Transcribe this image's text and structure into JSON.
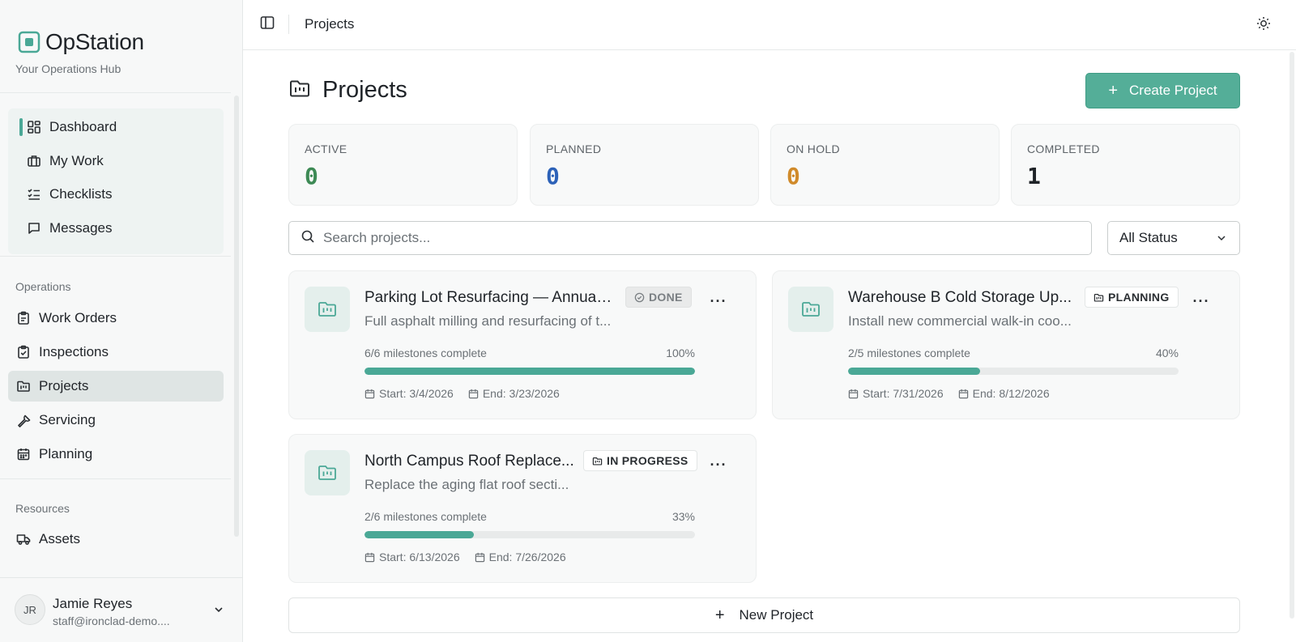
{
  "brand": {
    "title": "OpStation",
    "subtitle": "Your Operations Hub",
    "accent": "#4aa896"
  },
  "sidebar": {
    "top_items": [
      {
        "label": "Dashboard",
        "icon": "grid-icon"
      },
      {
        "label": "My Work",
        "icon": "briefcase-icon"
      },
      {
        "label": "Checklists",
        "icon": "checklist-icon"
      },
      {
        "label": "Messages",
        "icon": "message-icon"
      }
    ],
    "operations_label": "Operations",
    "operations_items": [
      {
        "label": "Work Orders",
        "icon": "clipboard-icon"
      },
      {
        "label": "Inspections",
        "icon": "clipboard-check-icon"
      },
      {
        "label": "Projects",
        "icon": "folder-kanban-icon",
        "active": true
      },
      {
        "label": "Servicing",
        "icon": "wrench-icon"
      },
      {
        "label": "Planning",
        "icon": "calendar-icon"
      }
    ],
    "resources_label": "Resources",
    "resources_items": [
      {
        "label": "Assets",
        "icon": "truck-icon"
      }
    ]
  },
  "user": {
    "initials": "JR",
    "name": "Jamie Reyes",
    "email": "staff@ironclad-demo...."
  },
  "topbar": {
    "breadcrumb": "Projects"
  },
  "page": {
    "title": "Projects",
    "create_label": "Create Project",
    "new_project_label": "New Project"
  },
  "stats": [
    {
      "label": "ACTIVE",
      "value": "0",
      "color": "#3d8a55"
    },
    {
      "label": "PLANNED",
      "value": "0",
      "color": "#2d62b8"
    },
    {
      "label": "ON HOLD",
      "value": "0",
      "color": "#d08a2a"
    },
    {
      "label": "COMPLETED",
      "value": "1",
      "color": "#1f2328"
    }
  ],
  "search": {
    "placeholder": "Search projects..."
  },
  "filter": {
    "selected": "All Status"
  },
  "projects": [
    {
      "title": "Parking Lot Resurfacing — Annual C...",
      "description": "Full asphalt milling and resurfacing of t...",
      "status": "DONE",
      "milestones": "6/6 milestones complete",
      "percent_label": "100%",
      "progress": 1.0,
      "start": "Start: 3/4/2026",
      "end": "End: 3/23/2026"
    },
    {
      "title": "Warehouse B Cold Storage Up...",
      "description": "Install new commercial walk-in coo...",
      "status": "PLANNING",
      "milestones": "2/5 milestones complete",
      "percent_label": "40%",
      "progress": 0.4,
      "start": "Start: 7/31/2026",
      "end": "End: 8/12/2026"
    },
    {
      "title": "North Campus Roof Replace...",
      "description": "Replace the aging flat roof secti...",
      "status": "IN PROGRESS",
      "milestones": "2/6 milestones complete",
      "percent_label": "33%",
      "progress": 0.33,
      "start": "Start: 6/13/2026",
      "end": "End: 7/26/2026"
    }
  ]
}
